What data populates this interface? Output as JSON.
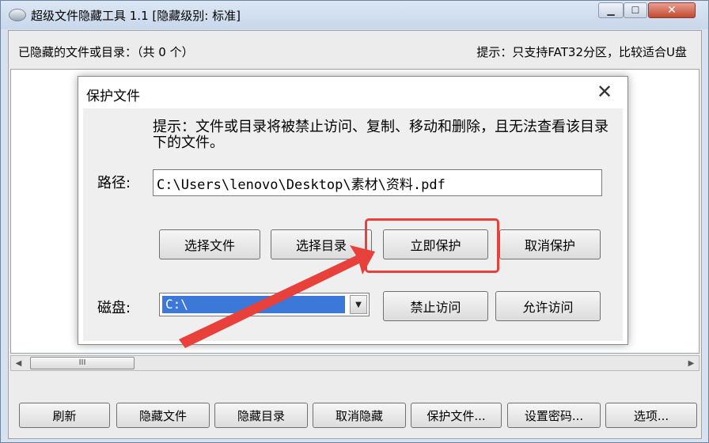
{
  "window": {
    "title": "超级文件隐藏工具 1.1 [隐藏级别: 标准]",
    "icons": {
      "app": "app-icon",
      "minimize": "minimize-icon",
      "maximize": "maximize-icon",
      "close": "close-icon"
    }
  },
  "main": {
    "hidden_count_label": "已隐藏的文件或目录：（共 0 个）",
    "hint": "提示：只支持FAT32分区，比较适合U盘",
    "scrollbar": {
      "thumb_grip": "III"
    }
  },
  "bottom_buttons": {
    "refresh": "刷新",
    "hide_file": "隐藏文件",
    "hide_dir": "隐藏目录",
    "cancel_hide": "取消隐藏",
    "protect_file": "保护文件...",
    "set_password": "设置密码...",
    "options": "选项..."
  },
  "dialog": {
    "title": "保护文件",
    "close_glyph": "✕",
    "hint": "提示：文件或目录将被禁止访问、复制、移动和删除，且无法查看该目录下的文件。",
    "path_label": "路径:",
    "path_value": "C:\\Users\\lenovo\\Desktop\\素材\\资料.pdf",
    "buttons": {
      "select_file": "选择文件",
      "select_dir": "选择目录",
      "protect_now": "立即保护",
      "cancel_protect": "取消保护",
      "deny_access": "禁止访问",
      "allow_access": "允许访问"
    },
    "disk_label": "磁盘:",
    "disk_value": "C:\\"
  },
  "annotation": {
    "highlight_color": "#e8403a",
    "arrow_color": "#e8403a"
  }
}
